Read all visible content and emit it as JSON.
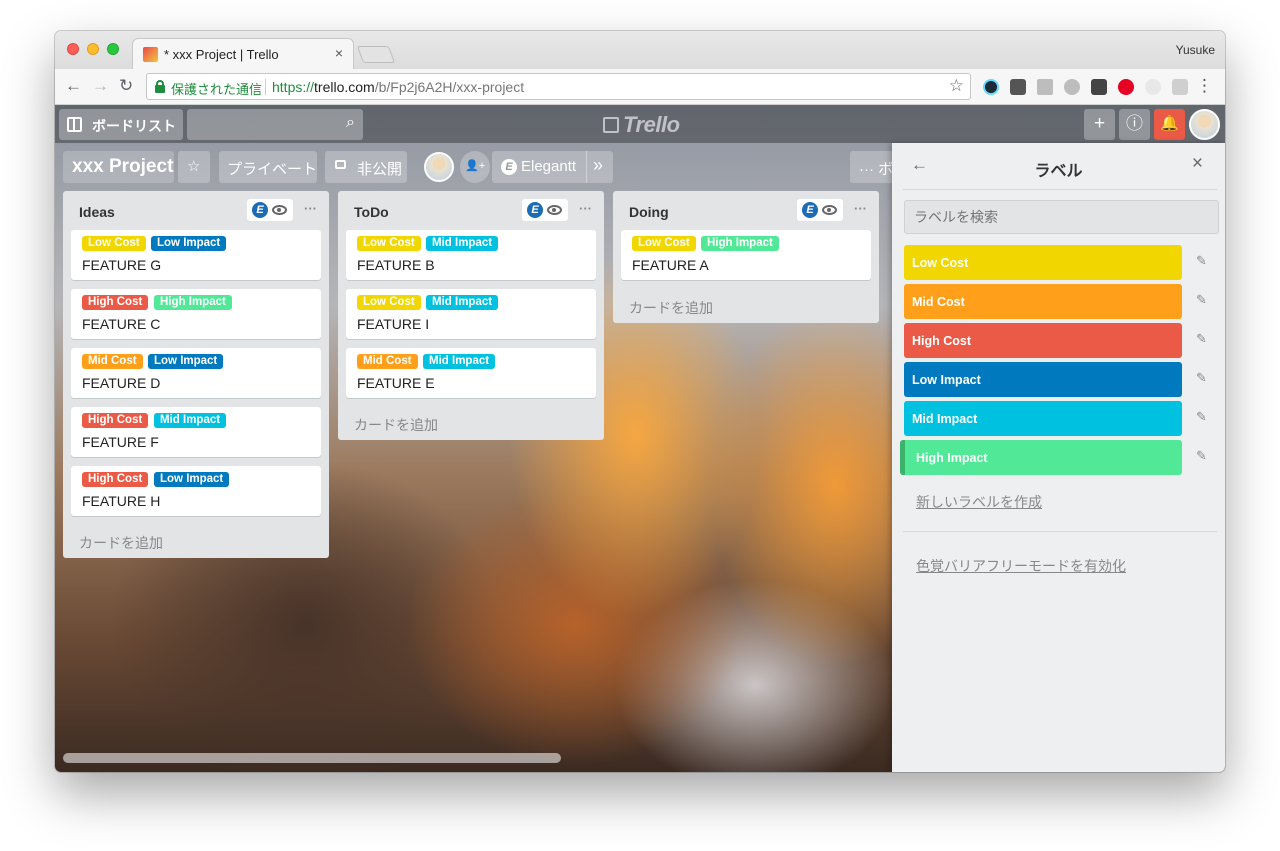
{
  "browser": {
    "tab_title": "* xxx Project | Trello",
    "tab_close": "×",
    "profile_name": "Yusuke",
    "back": "←",
    "forward": "→",
    "reload": "↻",
    "secure_text": "保護された通信",
    "url_scheme": "https://",
    "url_host": "trello.com",
    "url_path": "/b/Fp2j6A2H/xxx-project",
    "bookmark_star": "☆",
    "menu": "⋮",
    "extensions": [
      "react-icon",
      "pocket-icon",
      "drive-icon",
      "elegantt-icon",
      "g-ext-icon",
      "pinterest-icon",
      "rabbit-icon",
      "c-ext-icon"
    ]
  },
  "header": {
    "boards_label": "ボードリスト",
    "search_icon": "⌕",
    "logo_text": "Trello",
    "plus": "+",
    "info": "ⓘ",
    "bell": "🔔"
  },
  "board": {
    "title": "xxx Project",
    "star": "☆",
    "visibility_label": "プライベート",
    "private_label": "非公開",
    "invite_icon": "👤+",
    "elegantt_label": "Elegantt",
    "elegantt_mark": "E",
    "chevrons": "»",
    "more": "··· ボ"
  },
  "colors": {
    "low_cost": "#f2d600",
    "mid_cost": "#ff9f1a",
    "high_cost": "#eb5a46",
    "low_impact": "#0079bf",
    "mid_impact": "#00c2e0",
    "high_impact": "#51e898"
  },
  "lists": [
    {
      "title": "Ideas",
      "menu": "···",
      "add_card": "カードを追加",
      "cards": [
        {
          "title": "FEATURE G",
          "labels": [
            {
              "text": "Low Cost",
              "color": "#f2d600"
            },
            {
              "text": "Low Impact",
              "color": "#0079bf"
            }
          ]
        },
        {
          "title": "FEATURE C",
          "labels": [
            {
              "text": "High Cost",
              "color": "#eb5a46"
            },
            {
              "text": "High Impact",
              "color": "#51e898"
            }
          ]
        },
        {
          "title": "FEATURE D",
          "labels": [
            {
              "text": "Mid Cost",
              "color": "#ff9f1a"
            },
            {
              "text": "Low Impact",
              "color": "#0079bf"
            }
          ]
        },
        {
          "title": "FEATURE F",
          "labels": [
            {
              "text": "High Cost",
              "color": "#eb5a46"
            },
            {
              "text": "Mid Impact",
              "color": "#00c2e0"
            }
          ]
        },
        {
          "title": "FEATURE H",
          "labels": [
            {
              "text": "High Cost",
              "color": "#eb5a46"
            },
            {
              "text": "Low Impact",
              "color": "#0079bf"
            }
          ]
        }
      ]
    },
    {
      "title": "ToDo",
      "menu": "···",
      "add_card": "カードを追加",
      "cards": [
        {
          "title": "FEATURE B",
          "labels": [
            {
              "text": "Low Cost",
              "color": "#f2d600"
            },
            {
              "text": "Mid Impact",
              "color": "#00c2e0"
            }
          ]
        },
        {
          "title": "FEATURE I",
          "labels": [
            {
              "text": "Low Cost",
              "color": "#f2d600"
            },
            {
              "text": "Mid Impact",
              "color": "#00c2e0"
            }
          ]
        },
        {
          "title": "FEATURE E",
          "labels": [
            {
              "text": "Mid Cost",
              "color": "#ff9f1a"
            },
            {
              "text": "Mid Impact",
              "color": "#00c2e0"
            }
          ]
        }
      ]
    },
    {
      "title": "Doing",
      "menu": "···",
      "add_card": "カードを追加",
      "cards": [
        {
          "title": "FEATURE A",
          "labels": [
            {
              "text": "Low Cost",
              "color": "#f2d600"
            },
            {
              "text": "High Impact",
              "color": "#51e898"
            }
          ]
        }
      ]
    }
  ],
  "label_panel": {
    "back": "←",
    "title": "ラベル",
    "close": "×",
    "search_placeholder": "ラベルを検索",
    "edit_icon": "✎",
    "labels": [
      {
        "text": "Low Cost",
        "color": "#f2d600",
        "selected": false
      },
      {
        "text": "Mid Cost",
        "color": "#ff9f1a",
        "selected": false
      },
      {
        "text": "High Cost",
        "color": "#eb5a46",
        "selected": false
      },
      {
        "text": "Low Impact",
        "color": "#0079bf",
        "selected": false
      },
      {
        "text": "Mid Impact",
        "color": "#00c2e0",
        "selected": false
      },
      {
        "text": "High Impact",
        "color": "#51e898",
        "selected": true
      }
    ],
    "create_label": "新しいラベルを作成",
    "colorblind_mode": "色覚バリアフリーモードを有効化"
  }
}
